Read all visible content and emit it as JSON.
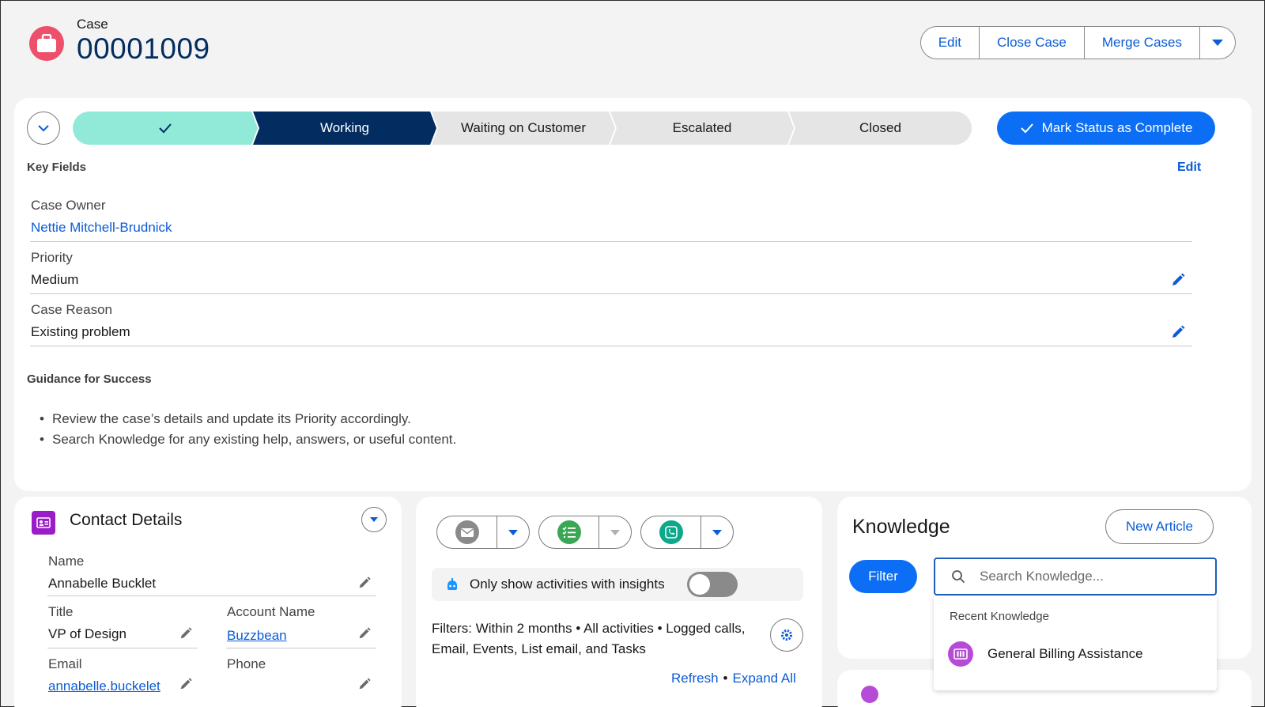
{
  "header": {
    "object_label": "Case",
    "case_number": "00001009",
    "actions": [
      "Edit",
      "Close Case",
      "Merge Cases"
    ]
  },
  "path": {
    "stages": [
      {
        "label": "",
        "state": "complete"
      },
      {
        "label": "Working",
        "state": "current"
      },
      {
        "label": "Waiting on Customer",
        "state": "todo"
      },
      {
        "label": "Escalated",
        "state": "todo"
      },
      {
        "label": "Closed",
        "state": "todo"
      }
    ],
    "mark_button": "Mark Status as Complete"
  },
  "key_fields": {
    "title": "Key Fields",
    "edit_label": "Edit",
    "fields": [
      {
        "label": "Case Owner",
        "value": "Nettie Mitchell-Brudnick",
        "link": true
      },
      {
        "label": "Priority",
        "value": "Medium",
        "link": false
      },
      {
        "label": "Case Reason",
        "value": "Existing problem",
        "link": false
      }
    ]
  },
  "guidance": {
    "title": "Guidance for Success",
    "items": [
      "Review the case’s details and update its Priority accordingly.",
      "Search Knowledge for any existing help, answers, or useful content."
    ]
  },
  "contact_details": {
    "title": "Contact Details",
    "name_label": "Name",
    "name_value": "Annabelle Bucklet",
    "title_label": "Title",
    "title_value": "VP of Design",
    "account_label": "Account Name",
    "account_value": "Buzzbean",
    "email_label": "Email",
    "email_value": "annabelle.buckelet",
    "phone_label": "Phone",
    "phone_value": ""
  },
  "activity": {
    "insights_label": "Only show activities with insights",
    "insights_enabled": false,
    "filters_text": "Filters: Within 2 months • All activities • Logged calls, Email, Events, List email, and Tasks",
    "refresh": "Refresh",
    "separator": "•",
    "expand_all": "Expand All"
  },
  "knowledge": {
    "title": "Knowledge",
    "new_article": "New Article",
    "filter": "Filter",
    "search_placeholder": "Search Knowledge...",
    "recent_label": "Recent Knowledge",
    "recent_items": [
      "General Billing Assistance"
    ]
  },
  "colors": {
    "accent": "#0b6ef5",
    "navy": "#032d60",
    "complete": "#91ead8",
    "case_icon": "#ee4f6b",
    "contact_icon": "#9a1ec8"
  }
}
